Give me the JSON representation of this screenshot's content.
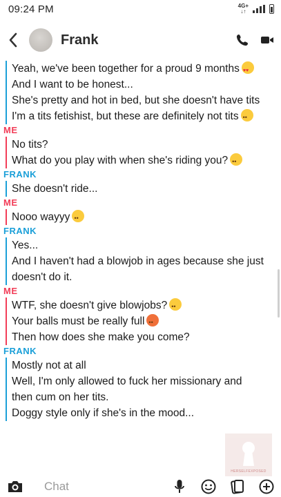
{
  "status_bar": {
    "time": "09:24 PM",
    "network": "4G+"
  },
  "header": {
    "contact_name": "Frank"
  },
  "messages": [
    {
      "sender": "",
      "side": "frank",
      "lines": [
        {
          "text": "Yeah, we've been together for a proud 9 months",
          "emoji": "heart"
        },
        {
          "text": "And I want to be honest...",
          "emoji": ""
        },
        {
          "text": "She's pretty and hot in bed, but she doesn't have tits",
          "emoji": ""
        },
        {
          "text": "I'm a tits fetishist, but these are definitely not tits",
          "emoji": "sad"
        }
      ]
    },
    {
      "sender": "ME",
      "side": "me",
      "lines": [
        {
          "text": "No tits?",
          "emoji": ""
        },
        {
          "text": "What do you play with when she's riding you?",
          "emoji": "think"
        }
      ]
    },
    {
      "sender": "FRANK",
      "side": "frank",
      "lines": [
        {
          "text": "She doesn't ride...",
          "emoji": ""
        }
      ]
    },
    {
      "sender": "ME",
      "side": "me",
      "lines": [
        {
          "text": "Nooo wayyy",
          "emoji": "neutral"
        }
      ]
    },
    {
      "sender": "FRANK",
      "side": "frank",
      "lines": [
        {
          "text": "Yes...",
          "emoji": ""
        },
        {
          "text": "And I haven't had a blowjob in ages because she just",
          "emoji": ""
        },
        {
          "text": "doesn't do it.",
          "emoji": ""
        }
      ]
    },
    {
      "sender": "ME",
      "side": "me",
      "lines": [
        {
          "text": "WTF, she doesn't give blowjobs?",
          "emoji": "think"
        },
        {
          "text": "Your balls must be really full",
          "emoji": "hot"
        },
        {
          "text": "Then how does she make you come?",
          "emoji": ""
        }
      ]
    },
    {
      "sender": "FRANK",
      "side": "frank",
      "lines": [
        {
          "text": "Mostly not at all",
          "emoji": ""
        },
        {
          "text": "Well, I'm only allowed to fuck her missionary and",
          "emoji": ""
        },
        {
          "text": "then cum on her tits.",
          "emoji": ""
        },
        {
          "text": "Doggy style only if she's in the mood...",
          "emoji": ""
        }
      ]
    }
  ],
  "chat_bar": {
    "placeholder": "Chat"
  },
  "watermark": {
    "text": "HERSELFEXPOSED"
  },
  "colors": {
    "me": "#f23c57",
    "frank": "#1a9fd8"
  },
  "icons": {
    "back": "chevron-left-icon",
    "call": "phone-icon",
    "video": "video-camera-icon",
    "camera": "camera-icon",
    "mic": "microphone-icon",
    "sticker": "smiley-icon",
    "cards": "cards-icon",
    "plus": "plus-icon"
  }
}
